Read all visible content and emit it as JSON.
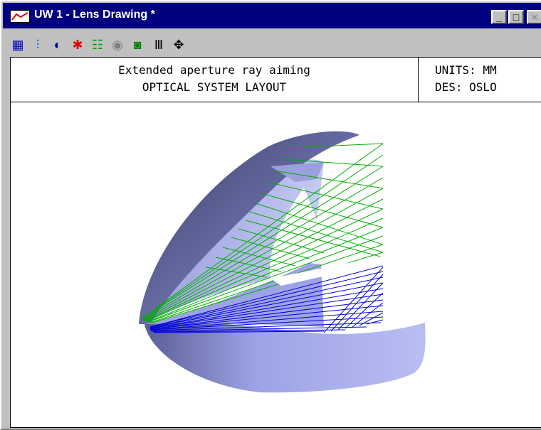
{
  "window": {
    "title": "UW 1 - Lens Drawing *",
    "buttons": {
      "minimize": "_",
      "maximize": "□",
      "close": "×"
    }
  },
  "toolbar": {
    "tools": [
      {
        "name": "grid-icon",
        "glyph": "▦",
        "color": "#0000c0"
      },
      {
        "name": "lens-layout-icon",
        "glyph": "⫶",
        "color": "#0060c0"
      },
      {
        "name": "rotate-icon",
        "glyph": "◐",
        "color": "#0000a0"
      },
      {
        "name": "ray-fan-icon",
        "glyph": "✱",
        "color": "#e00000"
      },
      {
        "name": "spot-diagram-icon",
        "glyph": "☷",
        "color": "#00a000"
      },
      {
        "name": "psf-icon",
        "glyph": "◉",
        "color": "#808080"
      },
      {
        "name": "target-icon",
        "glyph": "◙",
        "color": "#008000"
      },
      {
        "name": "bars-icon",
        "glyph": "Ⅲ",
        "color": "#000000"
      },
      {
        "name": "move-icon",
        "glyph": "✥",
        "color": "#000000"
      }
    ]
  },
  "header": {
    "line1": "Extended aperture ray aiming",
    "line2": "OPTICAL SYSTEM LAYOUT",
    "units": "UNITS: MM",
    "designer": "DES: OSLO"
  },
  "colors": {
    "titlebar": "#000080",
    "mirror_light": "#b8bdf2",
    "mirror_dark": "#3c3f66",
    "ray_upper": "#00b000",
    "ray_lower": "#0000e0"
  }
}
